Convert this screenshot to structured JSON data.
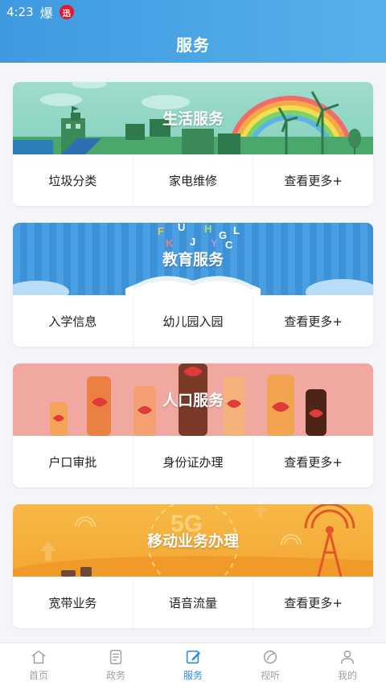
{
  "status_bar": {
    "time": "4:23",
    "flame_glyph": "爆",
    "badge_glyph": "迅"
  },
  "header": {
    "title": "服务"
  },
  "sections": [
    {
      "title": "生活服务",
      "banner_theme": "green-city-rainbow",
      "links": [
        "垃圾分类",
        "家电维修",
        "查看更多+"
      ]
    },
    {
      "title": "教育服务",
      "banner_theme": "blue-book",
      "links": [
        "入学信息",
        "幼儿园入园",
        "查看更多+"
      ]
    },
    {
      "title": "人口服务",
      "banner_theme": "pink-hands-hearts",
      "links": [
        "户口审批",
        "身份证办理",
        "查看更多+"
      ]
    },
    {
      "title": "移动业务办理",
      "banner_theme": "orange-5g-tower",
      "links": [
        "宽带业务",
        "语音流量",
        "查看更多+"
      ]
    }
  ],
  "tabbar": {
    "active": "服务",
    "items": [
      {
        "label": "首页",
        "icon": "home-icon"
      },
      {
        "label": "政务",
        "icon": "document-icon"
      },
      {
        "label": "服务",
        "icon": "edit-icon"
      },
      {
        "label": "视听",
        "icon": "leaf-icon"
      },
      {
        "label": "我的",
        "icon": "user-icon"
      }
    ]
  },
  "colors": {
    "header_start": "#3f99df",
    "header_end": "#58b1ea",
    "active_tab": "#2e8de0",
    "inactive_tab": "#9aa0a8",
    "banner_green": "#9fdccc",
    "banner_blue": "#4a9fe2",
    "banner_pink": "#f1a8a0",
    "banner_orange": "#f7b944"
  }
}
